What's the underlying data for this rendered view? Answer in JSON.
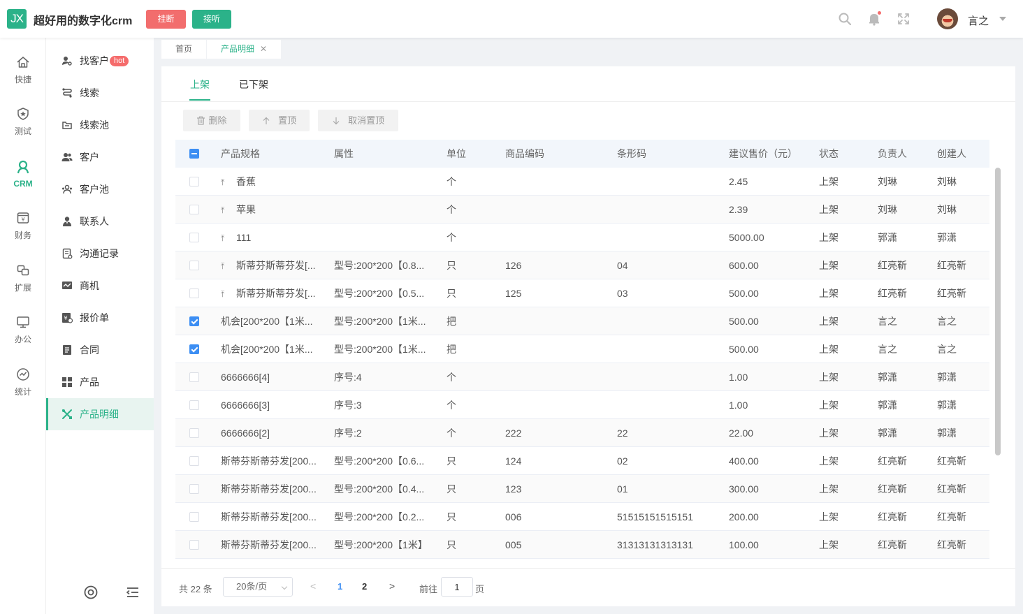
{
  "header": {
    "logo_text": "JX",
    "title": "超好用的数字化crm",
    "hang_label": "挂断",
    "answer_label": "接听",
    "username": "言之"
  },
  "rail": [
    {
      "label": "快捷",
      "icon": "home-icon"
    },
    {
      "label": "测试",
      "icon": "shield-star-icon"
    },
    {
      "label": "CRM",
      "icon": "user-circle-icon",
      "active": true
    },
    {
      "label": "财务",
      "icon": "yen-wallet-icon"
    },
    {
      "label": "扩展",
      "icon": "extend-icon"
    },
    {
      "label": "办公",
      "icon": "monitor-icon"
    },
    {
      "label": "统计",
      "icon": "chart-circle-icon"
    }
  ],
  "submenu": [
    {
      "label": "找客户",
      "badge": "hot"
    },
    {
      "label": "线索"
    },
    {
      "label": "线索池"
    },
    {
      "label": "客户"
    },
    {
      "label": "客户池"
    },
    {
      "label": "联系人"
    },
    {
      "label": "沟通记录"
    },
    {
      "label": "商机"
    },
    {
      "label": "报价单"
    },
    {
      "label": "合同"
    },
    {
      "label": "产品"
    },
    {
      "label": "产品明细",
      "active": true
    }
  ],
  "page_tabs": [
    {
      "label": "首页"
    },
    {
      "label": "产品明细",
      "active": true
    }
  ],
  "status_tabs": [
    {
      "label": "上架",
      "active": true
    },
    {
      "label": "已下架"
    }
  ],
  "toolbar": {
    "delete_label": "删除",
    "top_label": "置顶",
    "untop_label": "取消置顶"
  },
  "table": {
    "columns": [
      "产品规格",
      "属性",
      "单位",
      "商品编码",
      "条形码",
      "建议售价（元）",
      "状态",
      "负责人",
      "创建人"
    ],
    "rows": [
      {
        "pinned": true,
        "checked": false,
        "spec": "香蕉",
        "attr": "",
        "unit": "个",
        "code": "",
        "barcode": "",
        "price": "2.45",
        "status": "上架",
        "owner": "刘琳",
        "creator": "刘琳"
      },
      {
        "pinned": true,
        "checked": false,
        "spec": "苹果",
        "attr": "",
        "unit": "个",
        "code": "",
        "barcode": "",
        "price": "2.39",
        "status": "上架",
        "owner": "刘琳",
        "creator": "刘琳"
      },
      {
        "pinned": true,
        "checked": false,
        "spec": "111",
        "attr": "",
        "unit": "个",
        "code": "",
        "barcode": "",
        "price": "5000.00",
        "status": "上架",
        "owner": "郭潇",
        "creator": "郭潇"
      },
      {
        "pinned": true,
        "checked": false,
        "spec": "斯蒂芬斯蒂芬发[...",
        "attr": "型号:200*200【0.8...",
        "unit": "只",
        "code": "126",
        "barcode": "04",
        "price": "600.00",
        "status": "上架",
        "owner": "红亮靳",
        "creator": "红亮靳"
      },
      {
        "pinned": true,
        "checked": false,
        "spec": "斯蒂芬斯蒂芬发[...",
        "attr": "型号:200*200【0.5...",
        "unit": "只",
        "code": "125",
        "barcode": "03",
        "price": "500.00",
        "status": "上架",
        "owner": "红亮靳",
        "creator": "红亮靳"
      },
      {
        "pinned": false,
        "checked": true,
        "spec": "机会[200*200【1米...",
        "attr": "型号:200*200【1米...",
        "unit": "把",
        "code": "",
        "barcode": "",
        "price": "500.00",
        "status": "上架",
        "owner": "言之",
        "creator": "言之"
      },
      {
        "pinned": false,
        "checked": true,
        "spec": "机会[200*200【1米...",
        "attr": "型号:200*200【1米...",
        "unit": "把",
        "code": "",
        "barcode": "",
        "price": "500.00",
        "status": "上架",
        "owner": "言之",
        "creator": "言之"
      },
      {
        "pinned": false,
        "checked": false,
        "spec": "6666666[4]",
        "attr": "序号:4",
        "unit": "个",
        "code": "",
        "barcode": "",
        "price": "1.00",
        "status": "上架",
        "owner": "郭潇",
        "creator": "郭潇"
      },
      {
        "pinned": false,
        "checked": false,
        "spec": "6666666[3]",
        "attr": "序号:3",
        "unit": "个",
        "code": "",
        "barcode": "",
        "price": "1.00",
        "status": "上架",
        "owner": "郭潇",
        "creator": "郭潇"
      },
      {
        "pinned": false,
        "checked": false,
        "spec": "6666666[2]",
        "attr": "序号:2",
        "unit": "个",
        "code": "222",
        "barcode": "22",
        "price": "22.00",
        "status": "上架",
        "owner": "郭潇",
        "creator": "郭潇"
      },
      {
        "pinned": false,
        "checked": false,
        "spec": "斯蒂芬斯蒂芬发[200...",
        "attr": "型号:200*200【0.6...",
        "unit": "只",
        "code": "124",
        "barcode": "02",
        "price": "400.00",
        "status": "上架",
        "owner": "红亮靳",
        "creator": "红亮靳"
      },
      {
        "pinned": false,
        "checked": false,
        "spec": "斯蒂芬斯蒂芬发[200...",
        "attr": "型号:200*200【0.4...",
        "unit": "只",
        "code": "123",
        "barcode": "01",
        "price": "300.00",
        "status": "上架",
        "owner": "红亮靳",
        "creator": "红亮靳"
      },
      {
        "pinned": false,
        "checked": false,
        "spec": "斯蒂芬斯蒂芬发[200...",
        "attr": "型号:200*200【0.2...",
        "unit": "只",
        "code": "006",
        "barcode": "51515151515151",
        "price": "200.00",
        "status": "上架",
        "owner": "红亮靳",
        "creator": "红亮靳"
      },
      {
        "pinned": false,
        "checked": false,
        "spec": "斯蒂芬斯蒂芬发[200...",
        "attr": "型号:200*200【1米】",
        "unit": "只",
        "code": "005",
        "barcode": "31313131313131",
        "price": "100.00",
        "status": "上架",
        "owner": "红亮靳",
        "creator": "红亮靳"
      }
    ]
  },
  "pagination": {
    "total": "共 22 条",
    "page_size": "20条/页",
    "pages": [
      "1",
      "2"
    ],
    "current": "1",
    "goto_label": "前往",
    "goto_value": "1",
    "page_label": "页"
  },
  "colors": {
    "accent": "#2bb289",
    "danger": "#f26d6d",
    "primary": "#3c8ef3"
  }
}
